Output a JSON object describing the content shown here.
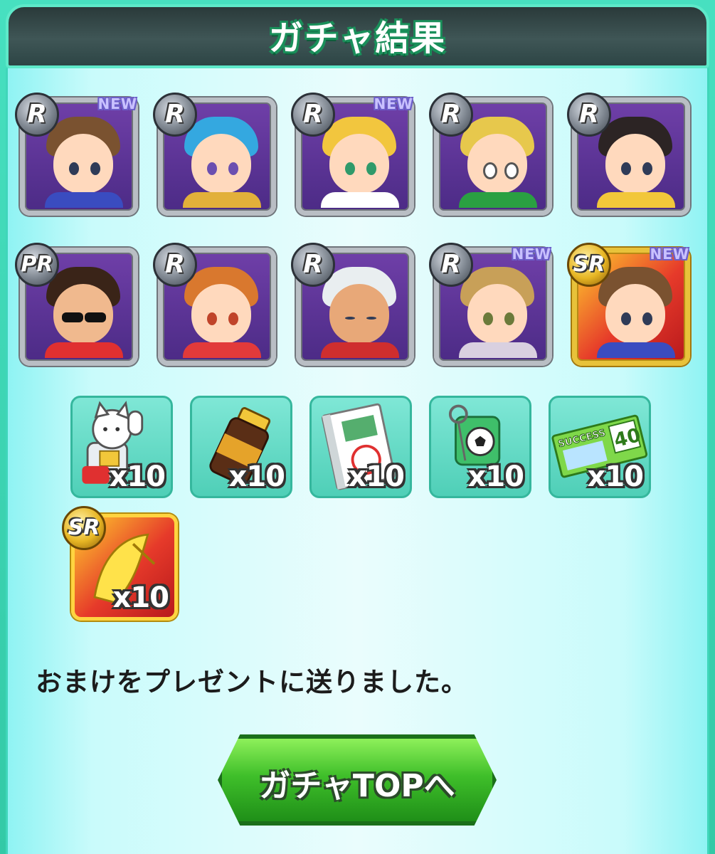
{
  "header": {
    "title": "ガチャ結果"
  },
  "characters": [
    {
      "rarity": "R",
      "new": "NEW",
      "hair": "#7a5230",
      "shirt": "#3a4cc0"
    },
    {
      "rarity": "R",
      "new": "",
      "hair": "#34a8e0",
      "shirt": "#e2b03a"
    },
    {
      "rarity": "R",
      "new": "NEW",
      "hair": "#f2c63e",
      "shirt": "#ffffff"
    },
    {
      "rarity": "R",
      "new": "",
      "hair": "#e7c84c",
      "shirt": "#2aa042"
    },
    {
      "rarity": "R",
      "new": "",
      "hair": "#2c2424",
      "shirt": "#f2c73a"
    },
    {
      "rarity": "PR",
      "new": "",
      "hair": "#3a2418",
      "shirt": "#e03030"
    },
    {
      "rarity": "R",
      "new": "",
      "hair": "#d9782e",
      "shirt": "#e23a3a"
    },
    {
      "rarity": "R",
      "new": "",
      "hair": "#e9eef0",
      "shirt": "#cf2e2e"
    },
    {
      "rarity": "R",
      "new": "NEW",
      "hair": "#c8a058",
      "shirt": "#d9d0e0"
    },
    {
      "rarity": "SR",
      "new": "NEW",
      "hair": "#7a5230",
      "shirt": "#3a4cc0"
    }
  ],
  "items": [
    {
      "icon": "lucky-cat-icon",
      "qty": "x10"
    },
    {
      "icon": "energy-drink-icon",
      "qty": "x10"
    },
    {
      "icon": "practice-book-icon",
      "qty": "x10"
    },
    {
      "icon": "soccer-keychain-icon",
      "qty": "x10"
    },
    {
      "icon": "success-ticket-icon",
      "qty": "x10",
      "ticket_text": "SUCCESS",
      "ticket_value": "40"
    }
  ],
  "bonus_item": {
    "rarity": "SR",
    "icon": "golden-item-icon",
    "qty": "x10"
  },
  "message": "おまけをプレゼントに送りました。",
  "button": {
    "label": "ガチャTOPへ"
  },
  "colors": {
    "frame": "#41d8b8",
    "header": "#2f4545",
    "button": "#3fbf2a"
  }
}
